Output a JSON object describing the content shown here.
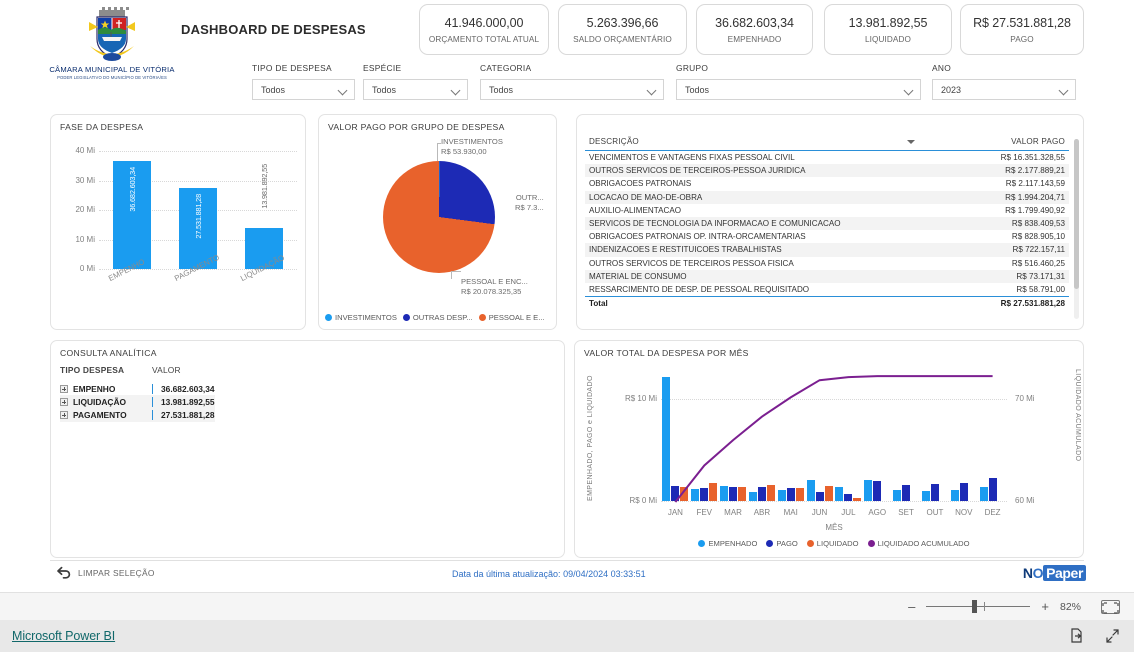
{
  "header": {
    "org_name": "CÂMARA MUNICIPAL DE VITÓRIA",
    "org_sub": "PODER LEGISLATIVO DO MUNICÍPIO DE VITÓRIA/ES",
    "title": "DASHBOARD DE DESPESAS"
  },
  "kpis": [
    {
      "value": "41.946.000,00",
      "label": "ORÇAMENTO TOTAL ATUAL"
    },
    {
      "value": "5.263.396,66",
      "label": "SALDO ORÇAMENTÁRIO"
    },
    {
      "value": "36.682.603,34",
      "label": "EMPENHADO"
    },
    {
      "value": "13.981.892,55",
      "label": "LIQUIDADO"
    },
    {
      "value": "R$ 27.531.881,28",
      "label": "PAGO"
    }
  ],
  "slicers": [
    {
      "label": "TIPO DE DESPESA",
      "value": "Todos"
    },
    {
      "label": "ESPÉCIE",
      "value": "Todos"
    },
    {
      "label": "CATEGORIA",
      "value": "Todos"
    },
    {
      "label": "GRUPO",
      "value": "Todos"
    },
    {
      "label": "ANO",
      "value": "2023"
    }
  ],
  "fase_despesa": {
    "title": "FASE DA DESPESA"
  },
  "pie_panel": {
    "title": "VALOR PAGO POR GRUPO DE DESPESA"
  },
  "table_panel": {
    "title_desc": "DESCRIÇÃO",
    "title_val": "VALOR PAGO",
    "total_label": "Total",
    "total_value": "R$ 27.531.881,28",
    "rows": [
      {
        "desc": "VENCIMENTOS E VANTAGENS FIXAS PESSOAL CIVIL",
        "val": "R$ 16.351.328,55"
      },
      {
        "desc": "OUTROS SERVICOS DE TERCEIROS-PESSOA JURIDICA",
        "val": "R$ 2.177.889,21"
      },
      {
        "desc": "OBRIGACOES PATRONAIS",
        "val": "R$ 2.117.143,59"
      },
      {
        "desc": "LOCACAO DE MAO-DE-OBRA",
        "val": "R$ 1.994.204,71"
      },
      {
        "desc": "AUXILIO-ALIMENTACAO",
        "val": "R$ 1.799.490,92"
      },
      {
        "desc": "SERVICOS DE TECNOLOGIA DA INFORMACAO E COMUNICACAO",
        "val": "R$ 838.409,53"
      },
      {
        "desc": "OBRIGACOES PATRONAIS OP. INTRA-ORCAMENTARIAS",
        "val": "R$ 828.905,10"
      },
      {
        "desc": "INDENIZACOES E RESTITUICOES TRABALHISTAS",
        "val": "R$ 722.157,11"
      },
      {
        "desc": "OUTROS SERVICOS DE TERCEIROS PESSOA FISICA",
        "val": "R$ 516.460,25"
      },
      {
        "desc": "MATERIAL DE CONSUMO",
        "val": "R$ 73.171,31"
      },
      {
        "desc": "RESSARCIMENTO DE DESP. DE PESSOAL REQUISITADO",
        "val": "R$ 58.791,00"
      }
    ]
  },
  "matrix_panel": {
    "title": "CONSULTA ANALÍTICA",
    "col1": "TIPO DESPESA",
    "col2": "VALOR",
    "rows": [
      {
        "tipo": "EMPENHO",
        "valor": "36.682.603,34"
      },
      {
        "tipo": "LIQUIDAÇÃO",
        "valor": "13.981.892,55"
      },
      {
        "tipo": "PAGAMENTO",
        "valor": "27.531.881,28"
      }
    ]
  },
  "monthly_panel": {
    "title": "VALOR TOTAL DA DESPESA POR MÊS"
  },
  "footer": {
    "clear_label": "LIMPAR SELEÇÃO",
    "update_text": "Data da última atualização: 09/04/2024 03:33:51",
    "brand_no": "N",
    "brand_o": "O",
    "brand_paper": "Paper"
  },
  "statusbar": {
    "minus": "–",
    "plus": "+",
    "zoom": "82%"
  },
  "taskbar": {
    "link": "Microsoft Power BI"
  },
  "colors": {
    "light_blue": "#1a9cf0",
    "navy": "#1d2ab5",
    "orange": "#e8622c",
    "purple": "#7b1f90",
    "accent_line": "#2a8fd8",
    "link": "#11686a"
  },
  "chart_data": [
    {
      "type": "bar",
      "title": "FASE DA DESPESA",
      "categories": [
        "EMPENHO",
        "PAGAMENTO",
        "LIQUIDAÇÃO"
      ],
      "values": [
        36682603.34,
        27531881.28,
        13981892.55
      ],
      "data_labels": [
        "36.682.603,34",
        "27.531.881,28",
        "13.981.892,55"
      ],
      "ylim": [
        0,
        40000000
      ],
      "ytick_labels": [
        "0 Mi",
        "10 Mi",
        "20 Mi",
        "30 Mi",
        "40 Mi"
      ],
      "ytick_values": [
        0,
        10000000,
        20000000,
        30000000,
        40000000
      ],
      "xlabel": "",
      "ylabel": "",
      "grid": true,
      "series_color": "#1a9cf0"
    },
    {
      "type": "pie",
      "title": "VALOR PAGO POR GRUPO DE DESPESA",
      "labels": [
        "INVESTIMENTOS",
        "OUTRAS DESP...",
        "PESSOAL E E..."
      ],
      "legend_labels": [
        "INVESTIMENTOS",
        "OUTRAS DESP...",
        "PESSOAL E E..."
      ],
      "callouts": [
        {
          "name": "INVESTIMENTOS",
          "value": "R$ 53.930,00"
        },
        {
          "name": "OUTR...",
          "value": "R$ 7.3..."
        },
        {
          "name": "PESSOAL E ENC...",
          "value": "R$ 20.078.325,35"
        }
      ],
      "values": [
        53930.0,
        7399625.93,
        20078325.35
      ],
      "colors": [
        "#1a9cf0",
        "#1d2ab5",
        "#e8622c"
      ],
      "legend_position": "bottom"
    },
    {
      "type": "bar",
      "title": "VALOR TOTAL DA DESPESA POR MÊS",
      "categories": [
        "JAN",
        "FEV",
        "MAR",
        "ABR",
        "MAI",
        "JUN",
        "JUL",
        "AGO",
        "SET",
        "OUT",
        "NOV",
        "DEZ"
      ],
      "xlabel": "MÊS",
      "ylabel": "EMPENHADO, PAGO e LIQUIDADO",
      "y2label": "LIQUIDADO ACUMULADO",
      "ylim": [
        0,
        13000000
      ],
      "ytick_labels": [
        "R$ 0 Mi",
        "R$ 10 Mi"
      ],
      "ytick_values": [
        0,
        10000000
      ],
      "y2lim": [
        60000000,
        73000000
      ],
      "y2tick_labels": [
        "60 Mi",
        "70 Mi"
      ],
      "y2tick_values": [
        60000000,
        70000000
      ],
      "legend_position": "bottom",
      "legend_labels": [
        "EMPENHADO",
        "PAGO",
        "LIQUIDADO",
        "LIQUIDADO ACUMULADO"
      ],
      "series": [
        {
          "name": "EMPENHADO",
          "color": "#1a9cf0",
          "values": [
            12200000,
            1150000,
            1500000,
            900000,
            1050000,
            2050000,
            1350000,
            2100000,
            1100000,
            1000000,
            1050000,
            1400000
          ]
        },
        {
          "name": "PAGO",
          "color": "#1d2ab5",
          "values": [
            1450000,
            1300000,
            1400000,
            1350000,
            1250000,
            900000,
            700000,
            1950000,
            1600000,
            1700000,
            1750000,
            2300000
          ]
        },
        {
          "name": "LIQUIDADO",
          "color": "#e8622c",
          "values": [
            1400000,
            1800000,
            1400000,
            1600000,
            1300000,
            1500000,
            250000,
            0,
            0,
            0,
            0,
            0
          ]
        },
        {
          "name": "LIQUIDADO ACUMULADO",
          "color": "#7b1f90",
          "type": "line",
          "axis": "y2",
          "values": [
            59900000,
            63500000,
            66000000,
            68300000,
            70200000,
            71900000,
            72200000,
            72300000,
            72300000,
            72300000,
            72300000,
            72300000
          ]
        }
      ]
    }
  ]
}
